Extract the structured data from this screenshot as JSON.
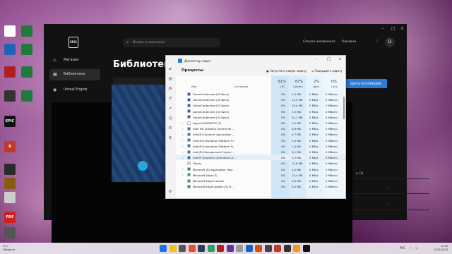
{
  "desktop": {
    "icons": [
      {
        "label": "",
        "color": "#ffffff"
      },
      {
        "label": "",
        "color": "#1f7a3c"
      },
      {
        "label": "",
        "color": "#1e63b8"
      },
      {
        "label": "",
        "color": "#1f7a3c"
      },
      {
        "label": "",
        "color": "#b02020"
      },
      {
        "label": "",
        "color": "#1f7a3c"
      },
      {
        "label": "",
        "color": "#333333"
      },
      {
        "label": "",
        "color": "#1f7a3c"
      },
      {
        "label": "EPIC",
        "color": "#111111"
      },
      {
        "label": "R",
        "color": "#c0392b"
      },
      {
        "label": "",
        "color": "#2a2a2a"
      },
      {
        "label": "",
        "color": "#8a5a10"
      },
      {
        "label": "",
        "color": "#cccccc"
      },
      {
        "label": "PDF",
        "color": "#d01f1f"
      },
      {
        "label": "",
        "color": "#555555"
      }
    ]
  },
  "epic": {
    "logo": "EPIC",
    "search_placeholder": "Искать в магазине",
    "wishlist": "Список желаемого",
    "cart": "Корзина",
    "avatar": "D",
    "nav": [
      {
        "label": "Магазин",
        "icon": "tag-icon"
      },
      {
        "label": "Библиотека",
        "icon": "grid-icon"
      },
      {
        "label": "Unreal Engine",
        "icon": "unreal-icon"
      }
    ],
    "page_title": "Библиотека",
    "collection_button": "ЗДАТЬ КОЛЛЕКЦИЮ",
    "list_rows": [
      "е (1)",
      "",
      ""
    ]
  },
  "taskmanager": {
    "title": "Диспетчер задач",
    "section": "Процессы",
    "run_task": "Запустить новую задачу",
    "end_task": "Завершить задачу",
    "columns": {
      "name": "Имя",
      "status": "Состояние",
      "cpu_pct": "61%",
      "cpu": "ЦП",
      "mem_pct": "67%",
      "mem": "Память",
      "disk_pct": "2%",
      "disk": "Диск",
      "net_pct": "0%",
      "net": "Сеть"
    },
    "rows": [
      {
        "name": "GameCenter.exe (32 бита)",
        "cpu": "0%",
        "mem": "1,4 МБ",
        "disk": "0 МБ/с",
        "net": "0 Мбит/с",
        "icon_color": "#1565c0",
        "expand": ""
      },
      {
        "name": "GameCenter.exe (32 бита)",
        "cpu": "0%",
        "mem": "13,0 МБ",
        "disk": "0 МБ/с",
        "net": "0 Мбит/с",
        "icon_color": "#1565c0",
        "expand": ""
      },
      {
        "name": "GameCenter.exe (32 бита)",
        "cpu": "0%",
        "mem": "15,4 МБ",
        "disk": "0 МБ/с",
        "net": "0 Мбит/с",
        "icon_color": "#1565c0",
        "expand": ""
      },
      {
        "name": "GameCenter.exe (32 бита)",
        "cpu": "0%",
        "mem": "1,5 МБ",
        "disk": "0 МБ/с",
        "net": "0 Мбит/с",
        "icon_color": "#1565c0",
        "expand": ""
      },
      {
        "name": "GameCenter.exe (32 бита)",
        "cpu": "0%",
        "mem": "20,1 МБ",
        "disk": "0 МБ/с",
        "net": "0 Мбит/с",
        "icon_color": "#1565c0",
        "expand": ""
      },
      {
        "name": "Hyperit NGENGTV (2)",
        "cpu": "0%",
        "mem": "1,5 МБ",
        "disk": "0 МБ/с",
        "net": "0 Мбит/с",
        "icon_color": "#ffffff",
        "expand": "›"
      },
      {
        "name": "Intel HD Graphics Drivers for ...",
        "cpu": "0%",
        "mem": "0,6 МБ",
        "disk": "0 МБ/с",
        "net": "0 Мбит/с",
        "icon_color": "#3a6fb0",
        "expand": "›"
      },
      {
        "name": "Intel(R) Dynamic Application ...",
        "cpu": "0%",
        "mem": "0,7 МБ",
        "disk": "0 МБ/с",
        "net": "0 Мбит/с",
        "icon_color": "#3a6fb0",
        "expand": "›"
      },
      {
        "name": "Intel(R) Innovation Platform Fr...",
        "cpu": "0%",
        "mem": "0,3 МБ",
        "disk": "0 МБ/с",
        "net": "0 Мбит/с",
        "icon_color": "#3a6fb0",
        "expand": "›"
      },
      {
        "name": "Intel(R) Innovation Platform Fr...",
        "cpu": "0%",
        "mem": "1,4 МБ",
        "disk": "0 МБ/с",
        "net": "0 Мбит/с",
        "icon_color": "#3a6fb0",
        "expand": "›"
      },
      {
        "name": "Intel(R) Management Engine ...",
        "cpu": "0%",
        "mem": "0,1 МБ",
        "disk": "0 МБ/с",
        "net": "0 Мбит/с",
        "icon_color": "#3a6fb0",
        "expand": "›"
      },
      {
        "name": "Intel® Graphics Command Ce...",
        "cpu": "0%",
        "mem": "0,3 МБ",
        "disk": "0 МБ/с",
        "net": "0 Мбит/с",
        "icon_color": "#0071c5",
        "expand": "›"
      },
      {
        "name": "iTunes",
        "cpu": "0%",
        "mem": "12,8 МБ",
        "disk": "0 МБ/с",
        "net": "0 Мбит/с",
        "icon_color": "#dddddd",
        "expand": ""
      },
      {
        "name": "Microsoft (R) Aggregator Host",
        "cpu": "0%",
        "mem": "0,5 МБ",
        "disk": "0 МБ/с",
        "net": "0 Мбит/с",
        "icon_color": "#3a6fb0",
        "expand": "›"
      },
      {
        "name": "Microsoft Edge (3)",
        "cpu": "0%",
        "mem": "13,4 МБ",
        "disk": "0 МБ/с",
        "net": "0 Мбит/с",
        "icon_color": "#2c9f6b",
        "expand": "›"
      },
      {
        "name": "Microsoft Edge Installer",
        "cpu": "0%",
        "mem": "0,6 МБ",
        "disk": "0 МБ/с",
        "net": "0 Мбит/с",
        "icon_color": "#2c9f6b",
        "expand": ""
      },
      {
        "name": "Microsoft Edge Update (32 б...",
        "cpu": "0%",
        "mem": "0,5 МБ",
        "disk": "0 МБ/с",
        "net": "0 Мбит/с",
        "icon_color": "#3a6fb0",
        "expand": ""
      }
    ]
  },
  "taskbar": {
    "weather_temp": "9°C",
    "weather_desc": "Облачно",
    "lang": "РУС",
    "time": "19:35",
    "date": "12.03.2023",
    "apps": [
      "#1a73e8",
      "#f1c40f",
      "#555555",
      "#e74c3c",
      "#2c3e50",
      "#2c9f6b",
      "#b02020",
      "#6b2fa0",
      "#999999",
      "#1565c0",
      "#d35400",
      "#444444",
      "#c0392b",
      "#333333",
      "#f39c12",
      "#111111"
    ]
  }
}
